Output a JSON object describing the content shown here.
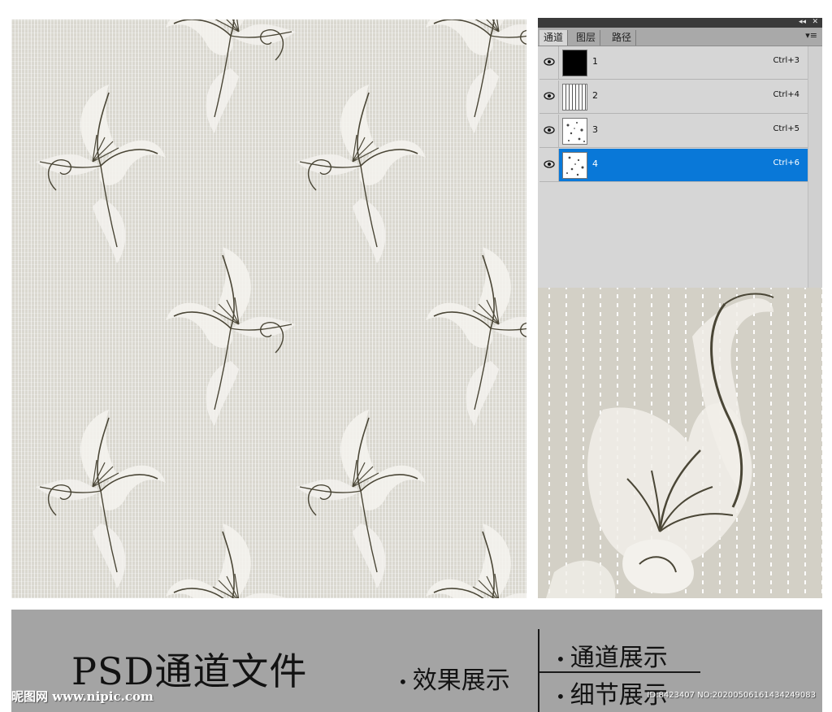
{
  "panel": {
    "tabs": [
      {
        "label": "通道",
        "active": true
      },
      {
        "label": "图层",
        "active": false
      },
      {
        "label": "路径",
        "active": false
      }
    ],
    "collapse_icon": "◂◂",
    "close_icon": "✕",
    "menu_icon": "▾≡",
    "channels": [
      {
        "name": "1",
        "shortcut": "Ctrl+3",
        "selected": false,
        "thumb": "black"
      },
      {
        "name": "2",
        "shortcut": "Ctrl+4",
        "selected": false,
        "thumb": "stripes"
      },
      {
        "name": "3",
        "shortcut": "Ctrl+5",
        "selected": false,
        "thumb": "speckle"
      },
      {
        "name": "4",
        "shortcut": "Ctrl+6",
        "selected": true,
        "thumb": "speckle"
      }
    ],
    "selected_color": "#0978d8"
  },
  "banner": {
    "title": "PSD通道文件",
    "item_effect": "效果展示",
    "item_channel": "通道展示",
    "item_detail": "细节展示",
    "bullet": "•"
  },
  "watermark": {
    "left": "昵图网 www.nipic.com",
    "right": "ID:8423407 NO:20200506161434249083"
  },
  "colors": {
    "pattern_bg": "#dad8d0",
    "banner_bg": "#a4a4a4",
    "flower_stroke": "#4a4636"
  }
}
